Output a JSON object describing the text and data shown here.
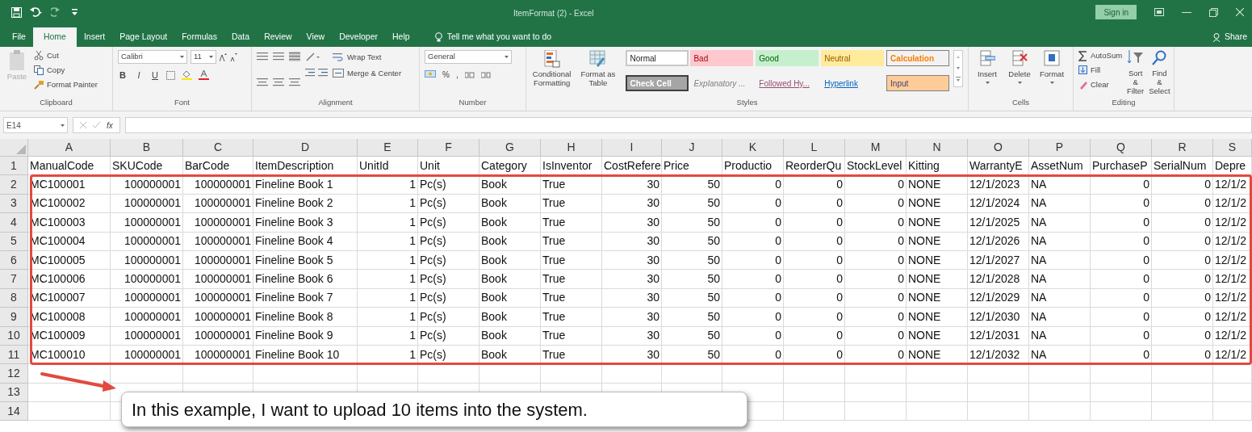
{
  "window": {
    "title": "ItemFormat (2) - Excel",
    "sign_in": "Sign in"
  },
  "tabs": [
    {
      "label": "File",
      "selected": false
    },
    {
      "label": "Home",
      "selected": true
    },
    {
      "label": "Insert",
      "selected": false
    },
    {
      "label": "Page Layout",
      "selected": false
    },
    {
      "label": "Formulas",
      "selected": false
    },
    {
      "label": "Data",
      "selected": false
    },
    {
      "label": "Review",
      "selected": false
    },
    {
      "label": "View",
      "selected": false
    },
    {
      "label": "Developer",
      "selected": false
    },
    {
      "label": "Help",
      "selected": false
    }
  ],
  "tell_me": {
    "placeholder": "Tell me what you want to do"
  },
  "share": "Share",
  "ribbon": {
    "clipboard": {
      "label": "Clipboard",
      "paste": "Paste",
      "items": [
        "Cut",
        "Copy",
        "Format Painter"
      ]
    },
    "font": {
      "label": "Font",
      "font_name": "Calibri",
      "font_size": "11",
      "format_buttons": [
        "B",
        "I",
        "U"
      ]
    },
    "alignment": {
      "label": "Alignment",
      "items": [
        "Wrap Text",
        "Merge & Center"
      ]
    },
    "number": {
      "label": "Number",
      "format": "General",
      "percent": "%",
      "comma": ","
    },
    "styles": {
      "label": "Styles",
      "commands": [
        "Conditional Formatting",
        "Format as Table"
      ],
      "cell_styles": [
        {
          "name": "Normal",
          "kind": "normal"
        },
        {
          "name": "Bad",
          "kind": "bad"
        },
        {
          "name": "Good",
          "kind": "good"
        },
        {
          "name": "Neutral",
          "kind": "neutral"
        },
        {
          "name": "Calculation",
          "kind": "calculation"
        },
        {
          "name": "Check Cell",
          "kind": "check"
        },
        {
          "name": "Explanatory ...",
          "kind": "explanatory"
        },
        {
          "name": "Followed Hy...",
          "kind": "followed"
        },
        {
          "name": "Hyperlink",
          "kind": "hyperlink"
        },
        {
          "name": "Input",
          "kind": "input"
        }
      ]
    },
    "cells": {
      "label": "Cells",
      "items": [
        "Insert",
        "Delete",
        "Format"
      ]
    },
    "editing": {
      "label": "Editing",
      "items": [
        "AutoSum",
        "Fill",
        "Clear"
      ],
      "buttons": [
        "Sort & Filter",
        "Find & Select"
      ]
    }
  },
  "formula_bar": {
    "name_box": "E14",
    "function_label": "fx"
  },
  "sheet": {
    "columns": [
      {
        "letter": "A",
        "kind": "text"
      },
      {
        "letter": "B",
        "kind": "number"
      },
      {
        "letter": "C",
        "kind": "number"
      },
      {
        "letter": "D",
        "kind": "text"
      },
      {
        "letter": "E",
        "kind": "number"
      },
      {
        "letter": "F",
        "kind": "text"
      },
      {
        "letter": "G",
        "kind": "text"
      },
      {
        "letter": "H",
        "kind": "text"
      },
      {
        "letter": "I",
        "kind": "number"
      },
      {
        "letter": "J",
        "kind": "number"
      },
      {
        "letter": "K",
        "kind": "number"
      },
      {
        "letter": "L",
        "kind": "number"
      },
      {
        "letter": "M",
        "kind": "number"
      },
      {
        "letter": "N",
        "kind": "text"
      },
      {
        "letter": "O",
        "kind": "text"
      },
      {
        "letter": "P",
        "kind": "text"
      },
      {
        "letter": "Q",
        "kind": "number"
      },
      {
        "letter": "R",
        "kind": "number"
      },
      {
        "letter": "S",
        "kind": "text"
      }
    ],
    "header_row": {
      "number": "1",
      "cells": [
        "ManualCode",
        "SKUCode",
        "BarCode",
        "ItemDescription",
        "UnitId",
        "Unit",
        "Category",
        "IsInventor",
        "CostRefere",
        "Price",
        "Productio",
        "ReorderQu",
        "StockLevel",
        "Kitting",
        "WarrantyE",
        "AssetNum",
        "PurchaseP",
        "SerialNum",
        "Depre"
      ]
    },
    "rows": [
      {
        "number": "2",
        "cells": [
          "MC100001",
          "100000001",
          "100000001",
          "Fineline Book 1",
          "1",
          "Pc(s)",
          "Book",
          "True",
          "30",
          "50",
          "0",
          "0",
          "0",
          "NONE",
          "12/1/2023",
          "NA",
          "0",
          "0",
          "12/1/2"
        ]
      },
      {
        "number": "3",
        "cells": [
          "MC100002",
          "100000001",
          "100000001",
          "Fineline Book 2",
          "1",
          "Pc(s)",
          "Book",
          "True",
          "30",
          "50",
          "0",
          "0",
          "0",
          "NONE",
          "12/1/2024",
          "NA",
          "0",
          "0",
          "12/1/2"
        ]
      },
      {
        "number": "4",
        "cells": [
          "MC100003",
          "100000001",
          "100000001",
          "Fineline Book 3",
          "1",
          "Pc(s)",
          "Book",
          "True",
          "30",
          "50",
          "0",
          "0",
          "0",
          "NONE",
          "12/1/2025",
          "NA",
          "0",
          "0",
          "12/1/2"
        ]
      },
      {
        "number": "5",
        "cells": [
          "MC100004",
          "100000001",
          "100000001",
          "Fineline Book 4",
          "1",
          "Pc(s)",
          "Book",
          "True",
          "30",
          "50",
          "0",
          "0",
          "0",
          "NONE",
          "12/1/2026",
          "NA",
          "0",
          "0",
          "12/1/2"
        ]
      },
      {
        "number": "6",
        "cells": [
          "MC100005",
          "100000001",
          "100000001",
          "Fineline Book 5",
          "1",
          "Pc(s)",
          "Book",
          "True",
          "30",
          "50",
          "0",
          "0",
          "0",
          "NONE",
          "12/1/2027",
          "NA",
          "0",
          "0",
          "12/1/2"
        ]
      },
      {
        "number": "7",
        "cells": [
          "MC100006",
          "100000001",
          "100000001",
          "Fineline Book 6",
          "1",
          "Pc(s)",
          "Book",
          "True",
          "30",
          "50",
          "0",
          "0",
          "0",
          "NONE",
          "12/1/2028",
          "NA",
          "0",
          "0",
          "12/1/2"
        ]
      },
      {
        "number": "8",
        "cells": [
          "MC100007",
          "100000001",
          "100000001",
          "Fineline Book 7",
          "1",
          "Pc(s)",
          "Book",
          "True",
          "30",
          "50",
          "0",
          "0",
          "0",
          "NONE",
          "12/1/2029",
          "NA",
          "0",
          "0",
          "12/1/2"
        ]
      },
      {
        "number": "9",
        "cells": [
          "MC100008",
          "100000001",
          "100000001",
          "Fineline Book 8",
          "1",
          "Pc(s)",
          "Book",
          "True",
          "30",
          "50",
          "0",
          "0",
          "0",
          "NONE",
          "12/1/2030",
          "NA",
          "0",
          "0",
          "12/1/2"
        ]
      },
      {
        "number": "10",
        "cells": [
          "MC100009",
          "100000001",
          "100000001",
          "Fineline Book 9",
          "1",
          "Pc(s)",
          "Book",
          "True",
          "30",
          "50",
          "0",
          "0",
          "0",
          "NONE",
          "12/1/2031",
          "NA",
          "0",
          "0",
          "12/1/2"
        ]
      },
      {
        "number": "11",
        "cells": [
          "MC100010",
          "100000001",
          "100000001",
          "Fineline Book 10",
          "1",
          "Pc(s)",
          "Book",
          "True",
          "30",
          "50",
          "0",
          "0",
          "0",
          "NONE",
          "12/1/2032",
          "NA",
          "0",
          "0",
          "12/1/2"
        ]
      },
      {
        "number": "12"
      },
      {
        "number": "13"
      },
      {
        "number": "14"
      }
    ]
  },
  "annotation": {
    "text": "In this example, I want to upload 10 items into the system."
  }
}
